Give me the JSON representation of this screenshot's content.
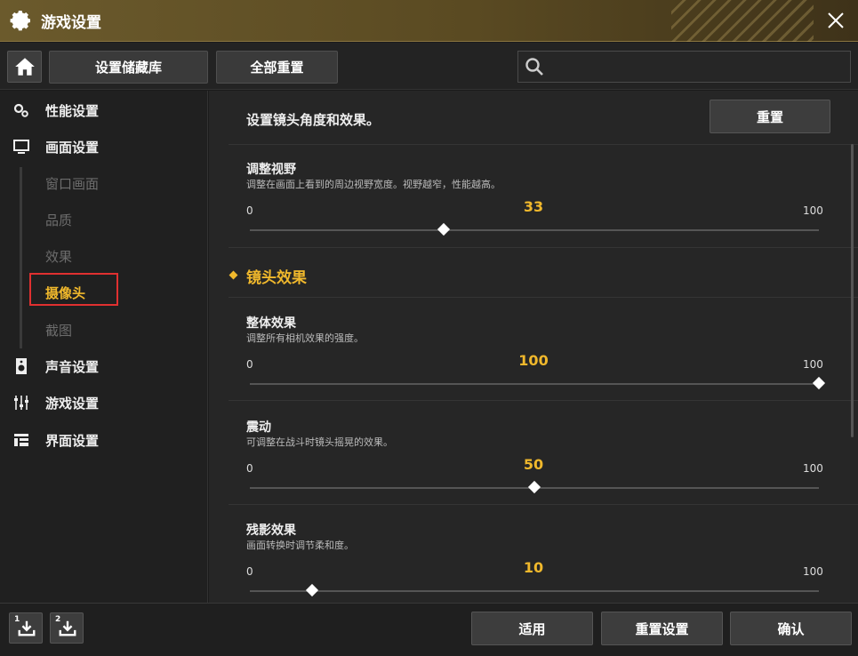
{
  "window": {
    "title": "游戏设置"
  },
  "toolbar": {
    "storage_label": "设置储藏库",
    "reset_all_label": "全部重置",
    "search_placeholder": ""
  },
  "sidebar": {
    "items": [
      {
        "label": "性能设置",
        "icon": "gears-icon"
      },
      {
        "label": "画面设置",
        "icon": "monitor-icon"
      },
      {
        "label": "声音设置",
        "icon": "speaker-icon"
      },
      {
        "label": "游戏设置",
        "icon": "sliders-icon"
      },
      {
        "label": "界面设置",
        "icon": "layout-icon"
      }
    ],
    "subitems": [
      "窗口画面",
      "品质",
      "效果",
      "摄像头",
      "截图"
    ],
    "active_subitem": "摄像头"
  },
  "main": {
    "header_desc": "设置镜头角度和效果。",
    "reset_label": "重置",
    "section_title": "镜头效果",
    "sliders": [
      {
        "name": "调整视野",
        "desc": "调整在画面上看到的周边视野宽度。视野越窄，性能越高。",
        "min": "0",
        "max": "100",
        "value": "33",
        "fraction": 0.34
      },
      {
        "name": "整体效果",
        "desc": "调整所有相机效果的强度。",
        "min": "0",
        "max": "100",
        "value": "100",
        "fraction": 1.0
      },
      {
        "name": "震动",
        "desc": "可调整在战斗时镜头摇晃的效果。",
        "min": "0",
        "max": "100",
        "value": "50",
        "fraction": 0.5
      },
      {
        "name": "残影效果",
        "desc": "画面转换时调节柔和度。",
        "min": "0",
        "max": "100",
        "value": "10",
        "fraction": 0.11
      }
    ]
  },
  "footer": {
    "slot1_label": "1",
    "slot2_label": "2",
    "apply_label": "适用",
    "reset_settings_label": "重置设置",
    "confirm_label": "确认"
  },
  "colors": {
    "accent": "#f0b82c",
    "highlight": "#e03030"
  }
}
